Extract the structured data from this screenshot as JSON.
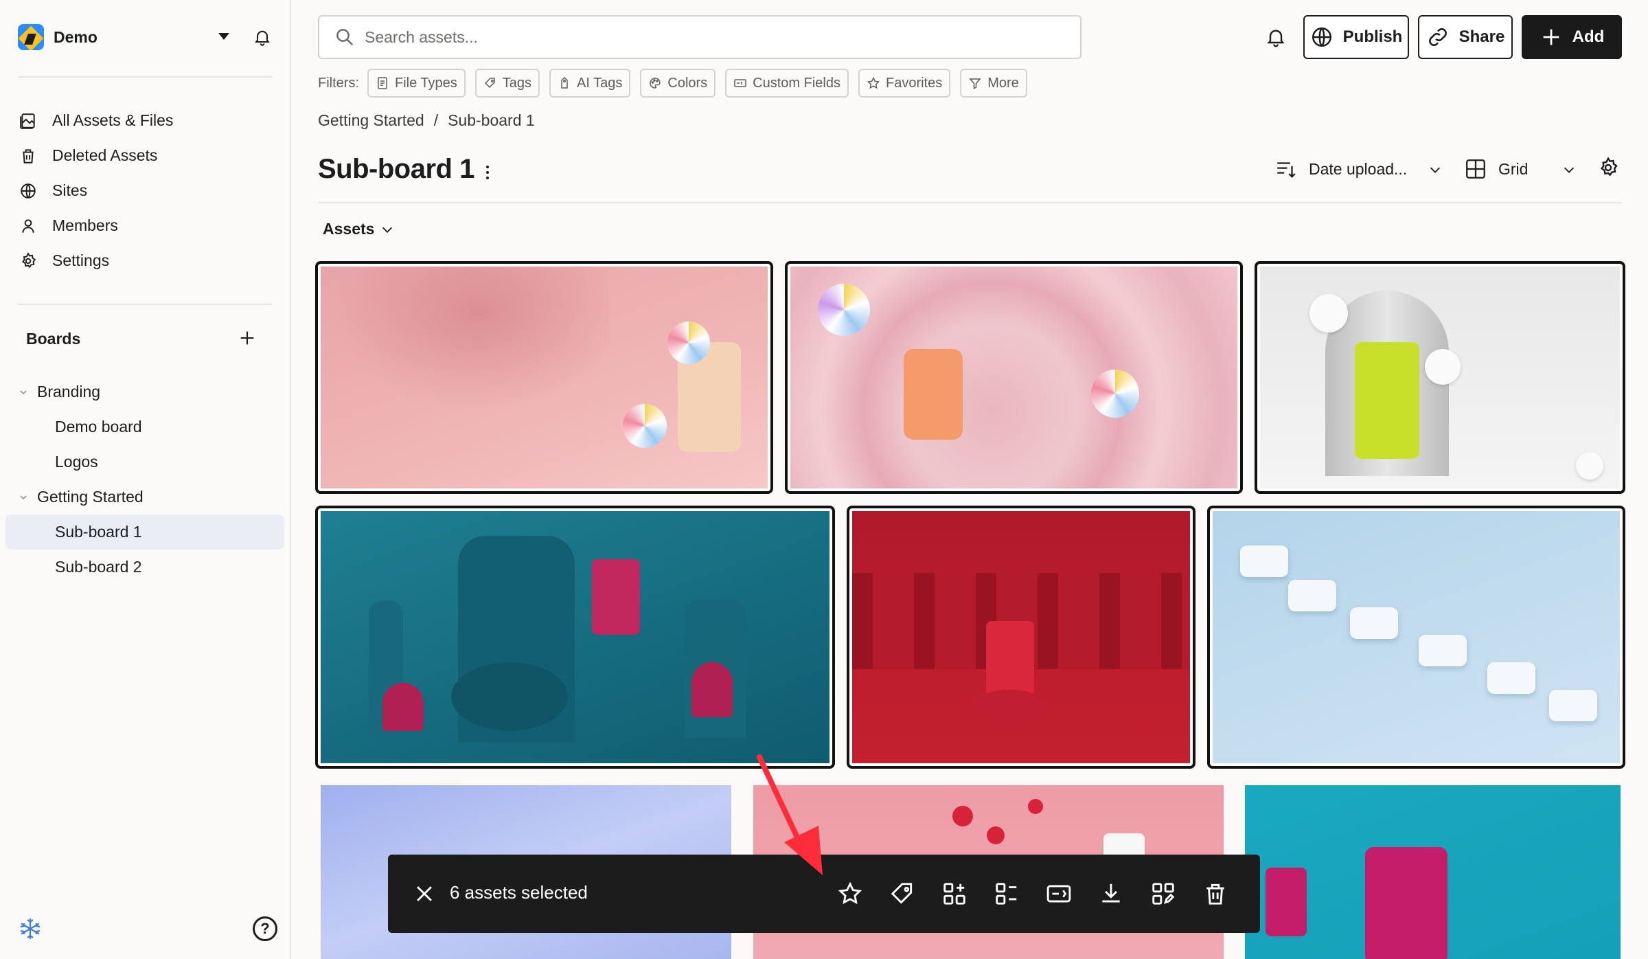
{
  "workspace": {
    "name": "Demo"
  },
  "sidebar": {
    "nav": [
      {
        "label": "All Assets & Files",
        "icon": "assets-icon"
      },
      {
        "label": "Deleted Assets",
        "icon": "trash-icon"
      },
      {
        "label": "Sites",
        "icon": "globe-icon"
      },
      {
        "label": "Members",
        "icon": "user-icon"
      },
      {
        "label": "Settings",
        "icon": "gear-icon"
      }
    ],
    "boards_heading": "Boards",
    "tree": [
      {
        "label": "Branding",
        "level": 1,
        "expanded": true
      },
      {
        "label": "Demo board",
        "level": 2
      },
      {
        "label": "Logos",
        "level": 2
      },
      {
        "label": "Getting Started",
        "level": 1,
        "expanded": true
      },
      {
        "label": "Sub-board 1",
        "level": 2,
        "active": true
      },
      {
        "label": "Sub-board 2",
        "level": 2
      }
    ],
    "help": "?"
  },
  "search": {
    "placeholder": "Search assets..."
  },
  "toolbar": {
    "publish": "Publish",
    "share": "Share",
    "add": "Add"
  },
  "filters": {
    "label": "Filters:",
    "chips": [
      "File Types",
      "Tags",
      "AI Tags",
      "Colors",
      "Custom Fields",
      "Favorites",
      "More"
    ]
  },
  "breadcrumb": {
    "parent": "Getting Started",
    "sep": "/",
    "current": "Sub-board 1"
  },
  "page": {
    "title": "Sub-board 1",
    "sort": "Date upload...",
    "view": "Grid",
    "section": "Assets"
  },
  "selection": {
    "count_text": "6 assets selected"
  },
  "colors": {
    "accent_dark": "#1a1a1a",
    "active_bg": "#ebedf5",
    "arrow": "#ff2d3a"
  }
}
